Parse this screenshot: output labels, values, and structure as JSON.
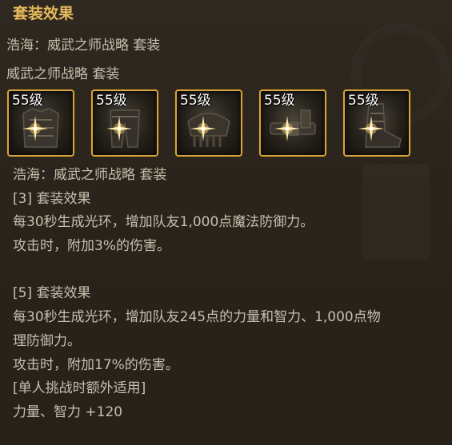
{
  "header": {
    "title": "套装效果"
  },
  "set_lines": [
    "浩海：威武之师战略 套装",
    "威武之师战略 套装"
  ],
  "slots": [
    {
      "level": "55级",
      "icon": "armor-chest-icon"
    },
    {
      "level": "55级",
      "icon": "armor-pants-icon"
    },
    {
      "level": "55级",
      "icon": "armor-shoulder-icon"
    },
    {
      "level": "55级",
      "icon": "armor-belt-icon"
    },
    {
      "level": "55级",
      "icon": "armor-boots-icon"
    }
  ],
  "description": {
    "set_name": "浩海：威武之师战略 套装",
    "effect3_header": "[3] 套装效果",
    "effect3_line1": "每30秒生成光环，增加队友1,000点魔法防御力。",
    "effect3_line2": "攻击时，附加3%的伤害。",
    "effect5_header": "[5] 套装效果",
    "effect5_line1": "每30秒生成光环，增加队友245点的力量和智力、1,000点物",
    "effect5_line2": "理防御力。",
    "effect5_line3": "攻击时，附加17%的伤害。",
    "solo_header": "[单人挑战时额外适用]",
    "solo_line": "力量、智力 +120"
  },
  "colors": {
    "title": "#e8b95d",
    "text": "#c9bfae",
    "slot_border": "#d7a43d",
    "background": "#2a241c"
  }
}
